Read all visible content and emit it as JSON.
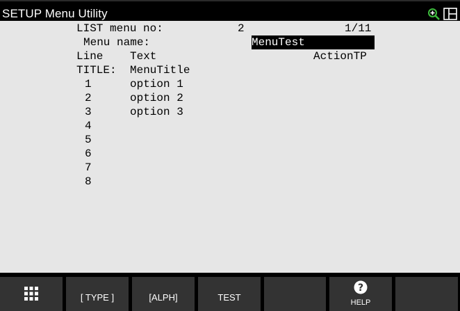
{
  "titlebar": {
    "title": "SETUP Menu Utility",
    "icons": [
      "zoom-in-icon",
      "split-screen-icon"
    ]
  },
  "content": {
    "header": {
      "list_label": "LIST menu no:",
      "list_value": "2",
      "page": "1/11",
      "menu_name_label": "Menu name:",
      "menu_name_value": "MenuTest",
      "col_line": "Line",
      "col_text": "Text",
      "action": "ActionTP",
      "title_label": "TITLE:",
      "title_value": "MenuTitle"
    },
    "rows": [
      {
        "num": "1",
        "text": "option 1"
      },
      {
        "num": "2",
        "text": "option 2"
      },
      {
        "num": "3",
        "text": "option 3"
      },
      {
        "num": "4",
        "text": ""
      },
      {
        "num": "5",
        "text": ""
      },
      {
        "num": "6",
        "text": ""
      },
      {
        "num": "7",
        "text": ""
      },
      {
        "num": "8",
        "text": ""
      }
    ]
  },
  "fkeys": {
    "f1": {
      "icon": "grid-menu-icon"
    },
    "f2": {
      "label": "[ TYPE ]"
    },
    "f3": {
      "label": "[ALPH]"
    },
    "f4": {
      "label": "TEST"
    },
    "f5": {
      "label": ""
    },
    "f6": {
      "label": "HELP",
      "icon": "help-icon"
    },
    "f7": {
      "label": ""
    }
  },
  "colors": {
    "background": "#e6e6e6",
    "bar": "#000000",
    "key": "#333333",
    "highlight": "#000000",
    "zoom_icon": "#3dbb3d"
  }
}
